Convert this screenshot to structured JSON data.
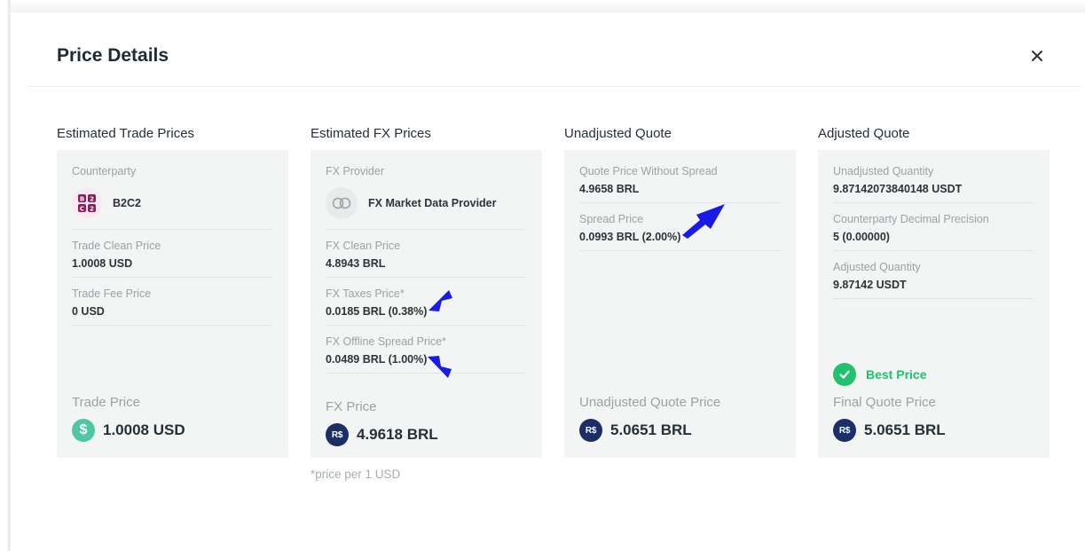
{
  "modal": {
    "title": "Price Details"
  },
  "columns": [
    {
      "title": "Estimated Trade Prices",
      "counterparty": {
        "label": "Counterparty",
        "name": "B2C2",
        "logo_icon": "b2c2-logo"
      },
      "fields": [
        {
          "label": "Trade Clean Price",
          "value": "1.0008 USD"
        },
        {
          "label": "Trade Fee Price",
          "value": "0 USD"
        }
      ],
      "total": {
        "label": "Trade Price",
        "value": "1.0008 USD",
        "icon": "dollar-coin-icon",
        "symbol": "$"
      }
    },
    {
      "title": "Estimated FX Prices",
      "provider": {
        "label": "FX Provider",
        "name": "FX Market Data Provider",
        "logo_icon": "fx-provider-logo"
      },
      "fields": [
        {
          "label": "FX Clean Price",
          "value": "4.8943 BRL"
        },
        {
          "label": "FX Taxes Price*",
          "value": "0.0185 BRL (0.38%)"
        },
        {
          "label": "FX Offline Spread Price*",
          "value": "0.0489 BRL (1.00%)"
        }
      ],
      "total": {
        "label": "FX Price",
        "value": "4.9618 BRL",
        "icon": "brl-coin-icon",
        "symbol": "R$"
      }
    },
    {
      "title": "Unadjusted Quote",
      "fields": [
        {
          "label": "Quote Price Without Spread",
          "value": "4.9658 BRL"
        },
        {
          "label": "Spread Price",
          "value": "0.0993 BRL (2.00%)"
        }
      ],
      "total": {
        "label": "Unadjusted Quote Price",
        "value": "5.0651 BRL",
        "icon": "brl-coin-icon",
        "symbol": "R$"
      }
    },
    {
      "title": "Adjusted Quote",
      "fields": [
        {
          "label": "Unadjusted Quantity",
          "value": "9.87142073840148 USDT"
        },
        {
          "label": "Counterparty Decimal Precision",
          "value": "5 (0.00000)"
        },
        {
          "label": "Adjusted Quantity",
          "value": "9.87142 USDT"
        }
      ],
      "badge": {
        "label": "Best Price",
        "icon": "check-circle-icon"
      },
      "total": {
        "label": "Final Quote Price",
        "value": "5.0651 BRL",
        "icon": "brl-coin-icon",
        "symbol": "R$"
      }
    }
  ],
  "footnote": "*price per 1 USD",
  "colors": {
    "accent_green": "#22c16b",
    "usd_coin": "#4fc6a6",
    "brl_coin": "#1b2f66",
    "annotation_arrow": "#1a1ae6",
    "card_background": "#f3f4f4"
  }
}
